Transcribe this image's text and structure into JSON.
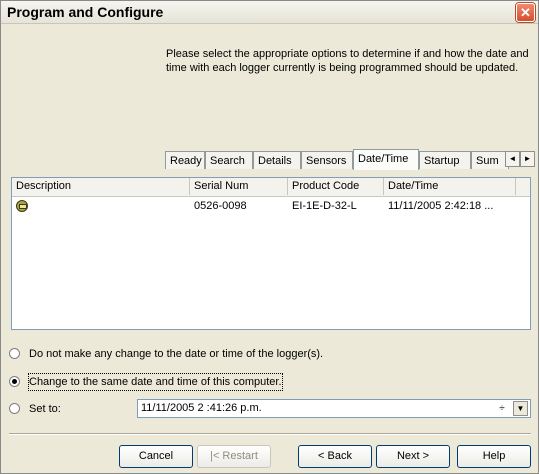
{
  "window": {
    "title": "Program and Configure",
    "close_symbol": "✕"
  },
  "instructions": "Please select the appropriate options to determine if and how the date and time with each logger currently is being programmed should be updated.",
  "tabs": [
    {
      "label": "Ready"
    },
    {
      "label": "Search"
    },
    {
      "label": "Details"
    },
    {
      "label": "Sensors"
    },
    {
      "label": "Date/Time",
      "active": true
    },
    {
      "label": "Startup"
    },
    {
      "label": "Sum"
    }
  ],
  "tab_scroll": {
    "left": "◄",
    "right": "►"
  },
  "list": {
    "columns": [
      "Description",
      "Serial Num",
      "Product Code",
      "Date/Time"
    ],
    "rows": [
      {
        "icon": "logger-icon",
        "description": "",
        "serial": "0526-0098",
        "product_code": "EI-1E-D-32-L",
        "datetime": "11/11/2005 2:42:18 ..."
      }
    ]
  },
  "options": {
    "no_change": "Do not make any change to the date or time of the logger(s).",
    "same_as_computer": "Change to the same date and time of this computer.",
    "set_to": "Set to:",
    "selected": "same_as_computer"
  },
  "datetime_value": "11/11/2005   2 :41:26 p.m.",
  "datetime_spin": "÷",
  "datetime_dropdown": "▼",
  "buttons": {
    "cancel": "Cancel",
    "restart": "|< Restart",
    "back": "< Back",
    "next": "Next >",
    "help": "Help"
  }
}
